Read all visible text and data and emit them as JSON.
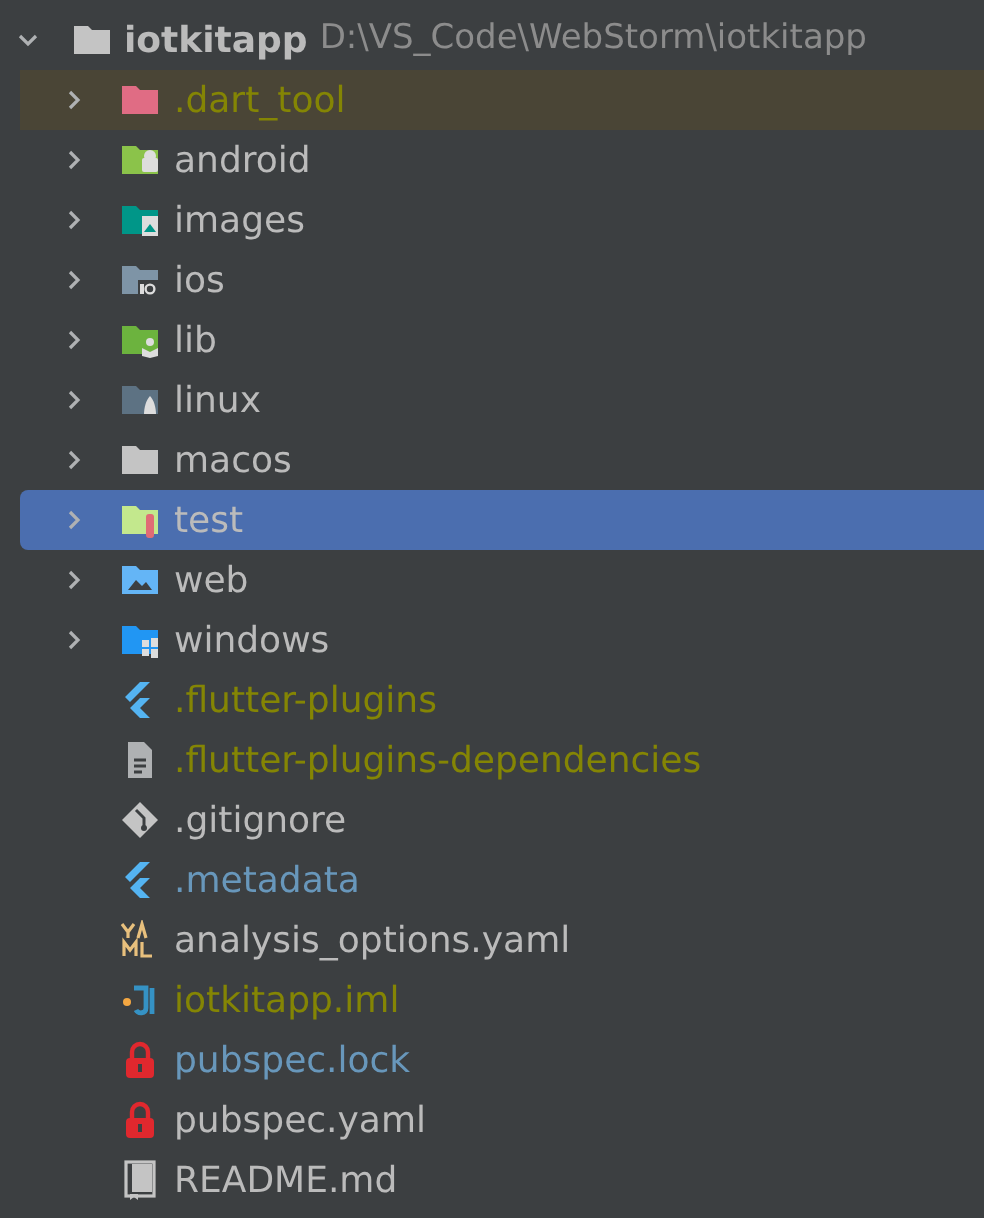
{
  "root": {
    "name": "iotkitapp",
    "path": "D:\\VS_Code\\WebStorm\\iotkitapp",
    "expanded": true,
    "children": [
      {
        "kind": "excluded",
        "name": ".dart_tool",
        "ignored": true,
        "expanded": false,
        "highlighted": true,
        "selected": false
      },
      {
        "kind": "android",
        "name": "android",
        "expanded": false,
        "selected": false
      },
      {
        "kind": "images",
        "name": "images",
        "expanded": false,
        "selected": false
      },
      {
        "kind": "ios",
        "name": "ios",
        "expanded": false,
        "selected": false
      },
      {
        "kind": "source",
        "name": "lib",
        "expanded": false,
        "selected": false
      },
      {
        "kind": "linux",
        "name": "linux",
        "expanded": false,
        "selected": false
      },
      {
        "kind": "folder",
        "name": "macos",
        "expanded": false,
        "selected": false
      },
      {
        "kind": "test",
        "name": "test",
        "expanded": false,
        "selected": true
      },
      {
        "kind": "web",
        "name": "web",
        "expanded": false,
        "selected": false
      },
      {
        "kind": "windows",
        "name": "windows",
        "expanded": false,
        "selected": false
      },
      {
        "kind": "flutter",
        "name": ".flutter-plugins",
        "ignored": true,
        "selected": false
      },
      {
        "kind": "text",
        "name": ".flutter-plugins-dependencies",
        "ignored": true,
        "selected": false
      },
      {
        "kind": "git",
        "name": ".gitignore",
        "selected": false
      },
      {
        "kind": "flutter",
        "name": ".metadata",
        "modified": true,
        "selected": false
      },
      {
        "kind": "yaml",
        "name": "analysis_options.yaml",
        "selected": false
      },
      {
        "kind": "iml",
        "name": "iotkitapp.iml",
        "ignored": true,
        "selected": false
      },
      {
        "kind": "lock",
        "name": "pubspec.lock",
        "modified": true,
        "selected": false
      },
      {
        "kind": "lock",
        "name": "pubspec.yaml",
        "selected": false
      },
      {
        "kind": "readme",
        "name": "README.md",
        "selected": false
      }
    ]
  }
}
